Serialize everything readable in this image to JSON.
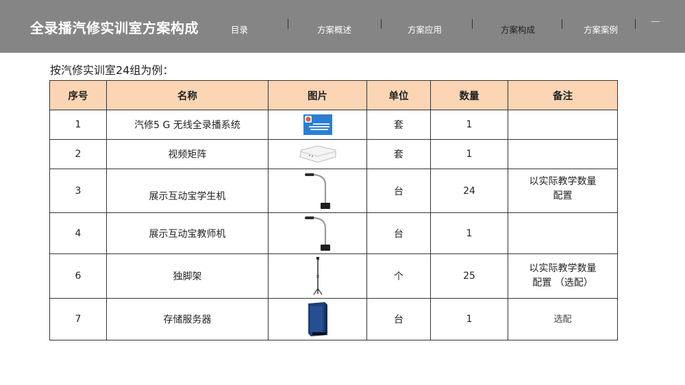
{
  "header": {
    "title": "全录播汽修实训室方案构成",
    "nav": [
      {
        "label": "目录",
        "active": false
      },
      {
        "label": "方案概述",
        "active": false
      },
      {
        "label": "方案应用",
        "active": false
      },
      {
        "label": "方案构成",
        "active": true
      },
      {
        "label": "方案案例",
        "active": false
      }
    ]
  },
  "intro": "按汽修实训室24组为例：",
  "table": {
    "headers": [
      "序号",
      "名称",
      "图片",
      "单位",
      "数量",
      "备注"
    ],
    "rows": [
      {
        "index": "1",
        "name": "汽修5 G 无线全录播系统",
        "image": "software-box",
        "unit": "套",
        "qty": "1",
        "note_lines": []
      },
      {
        "index": "2",
        "name": "视频矩阵",
        "image": "white-box-device",
        "unit": "套",
        "qty": "1",
        "note_lines": []
      },
      {
        "index": "3",
        "name": "展示互动宝学生机",
        "image": "gooseneck-camera",
        "unit": "台",
        "qty": "24",
        "note_lines": [
          "以实际教学数量",
          "配置"
        ]
      },
      {
        "index": "4",
        "name": "展示互动宝教师机",
        "image": "gooseneck-camera",
        "unit": "台",
        "qty": "1",
        "note_lines": []
      },
      {
        "index": "6",
        "name": "独脚架",
        "image": "monopod",
        "unit": "个",
        "qty": "25",
        "note_lines": [
          "以实际教学数量",
          "配置 （选配）"
        ]
      },
      {
        "index": "7",
        "name": "存储服务器",
        "image": "tower-server",
        "unit": "台",
        "qty": "1",
        "note_lines": [
          "选配"
        ]
      }
    ]
  },
  "colors": {
    "header_bg": "#858585",
    "table_header_bg": "#fcd5b4",
    "border": "#333333"
  }
}
